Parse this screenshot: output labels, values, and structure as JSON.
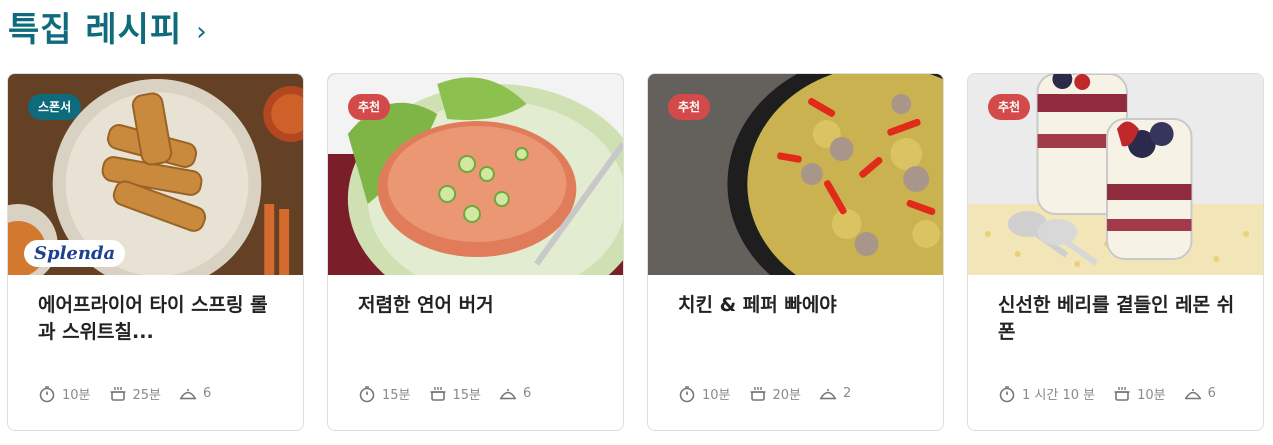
{
  "header": {
    "title": "특집 레시피",
    "chevron": "›"
  },
  "cards": [
    {
      "badge": "스폰서",
      "badge_type": "sponsor",
      "title": "에어프라이어 타이 스프링 롤과 스위트칠...",
      "prep_time": "10분",
      "cook_time": "25분",
      "servings": "6",
      "brand_logo": "Splenda"
    },
    {
      "badge": "추천",
      "badge_type": "recommend",
      "title": "저렴한 연어 버거",
      "prep_time": "15분",
      "cook_time": "15분",
      "servings": "6"
    },
    {
      "badge": "추천",
      "badge_type": "recommend",
      "title": "치킨 & 페퍼 빠에야",
      "prep_time": "10분",
      "cook_time": "20분",
      "servings": "2"
    },
    {
      "badge": "추천",
      "badge_type": "recommend",
      "title": "신선한 베리를 곁들인 레몬 쉬폰",
      "prep_time": "1 시간 10 분",
      "cook_time": "10분",
      "servings": "6"
    }
  ],
  "colors": {
    "accent": "#0e6b7b",
    "recommend_badge": "#d44a4a",
    "sponsor_badge": "#0e6b7b"
  },
  "icons": {
    "prep": "stopwatch-icon",
    "cook": "pot-icon",
    "servings": "serving-dish-icon"
  }
}
